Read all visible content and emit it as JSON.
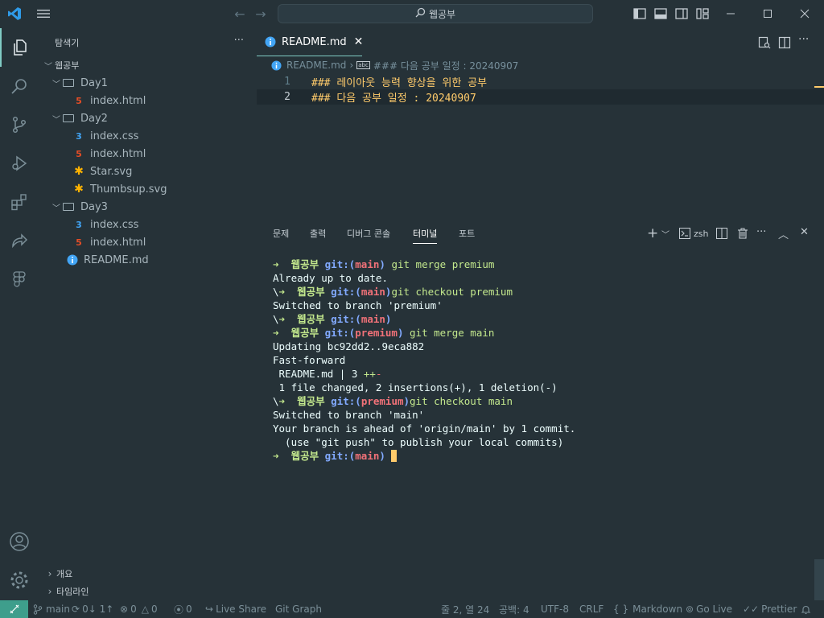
{
  "title_bar": {
    "search_text": "웹공부"
  },
  "sidebar": {
    "header": "탐색기",
    "root": "웹공부",
    "tree": [
      {
        "label": "Day1",
        "type": "folder"
      },
      {
        "label": "index.html",
        "type": "html"
      },
      {
        "label": "Day2",
        "type": "folder"
      },
      {
        "label": "index.css",
        "type": "css"
      },
      {
        "label": "index.html",
        "type": "html"
      },
      {
        "label": "Star.svg",
        "type": "svg"
      },
      {
        "label": "Thumbsup.svg",
        "type": "svg"
      },
      {
        "label": "Day3",
        "type": "folder"
      },
      {
        "label": "index.css",
        "type": "css"
      },
      {
        "label": "index.html",
        "type": "html"
      },
      {
        "label": "README.md",
        "type": "md"
      }
    ],
    "outline": "개요",
    "timeline": "타임라인"
  },
  "editor": {
    "tab_label": "README.md",
    "breadcrumb_file": "README.md",
    "breadcrumb_symbol": "### 다음 공부 일정 : 20240907",
    "lines": [
      {
        "num": "1",
        "hash": "###",
        "text": "레이아웃 능력 향상을 위한 공부"
      },
      {
        "num": "2",
        "hash": "###",
        "text": "다음 공부 일정 : 20240907"
      }
    ]
  },
  "panel": {
    "tabs": [
      "문제",
      "출력",
      "디버그 콘솔",
      "터미널",
      "포트"
    ],
    "active_tab": "터미널",
    "shell": "zsh"
  },
  "terminal": {
    "l1_dir": "웹공부",
    "l1_git": "git:(",
    "l1_branch": "main",
    "l1_close": ")",
    "l1_cmd": "git merge premium",
    "l2": "Already up to date.",
    "l3_pre": "\\",
    "l3_dir": "웹공부",
    "l3_branch": "main",
    "l3_cmd": "git checkout premium",
    "l4": "Switched to branch 'premium'",
    "l5_pre": "\\",
    "l5_dir": "웹공부",
    "l5_branch": "main",
    "l6_dir": "웹공부",
    "l6_branch": "premium",
    "l6_cmd": "git merge main",
    "l7": "Updating bc92dd2..9eca882",
    "l8": "Fast-forward",
    "l9_file": " README.md | 3 ",
    "l9_plus": "++",
    "l9_minus": "-",
    "l10": " 1 file changed, 2 insertions(+), 1 deletion(-)",
    "l11_pre": "\\",
    "l11_dir": "웹공부",
    "l11_branch": "premium",
    "l11_cmd": "git checkout main",
    "l12": "Switched to branch 'main'",
    "l13": "Your branch is ahead of 'origin/main' by 1 commit.",
    "l14": "  (use \"git push\" to publish your local commits)",
    "l15_dir": "웹공부",
    "l15_branch": "main"
  },
  "status_bar": {
    "branch": "main",
    "sync": "0↓ 1↑",
    "errors": "0",
    "warnings": "0",
    "ports": "0",
    "live_share": "Live Share",
    "git_graph": "Git Graph",
    "position": "줄 2, 열 24",
    "spaces": "공백: 4",
    "encoding": "UTF-8",
    "eol": "CRLF",
    "language": "Markdown",
    "go_live": "Go Live",
    "prettier": "Prettier"
  },
  "colors": {
    "background": "#263238",
    "accent": "#80cbc4",
    "remote": "#3e9e8c",
    "heading": "#ffcb6b",
    "terminal_green": "#c3e88d",
    "terminal_blue": "#82aaff",
    "terminal_red": "#f07178"
  }
}
